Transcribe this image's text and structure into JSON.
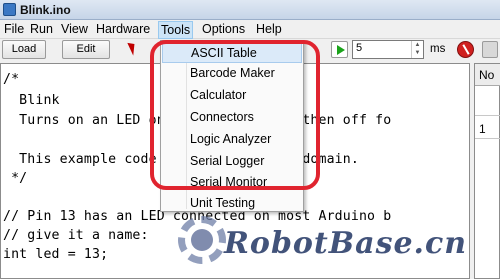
{
  "window": {
    "title": "Blink.ino",
    "icon": "arduino-app-icon"
  },
  "menubar": {
    "items": [
      "File",
      "Run",
      "View",
      "Hardware",
      "Tools",
      "Options",
      "Help"
    ],
    "active": "Tools"
  },
  "toolbar": {
    "load_label": "Load",
    "edit_label": "Edit",
    "interval_value": "5",
    "interval_unit": "ms",
    "icons": [
      "cursor-icon",
      "play-icon",
      "stop-icon"
    ]
  },
  "editor": {
    "lines": [
      "/*",
      "  Blink",
      "  Turns on an LED on for one second, then off fo",
      "",
      "  This example code is in the public domain.",
      " */",
      "",
      "// Pin 13 has an LED connected on most Arduino b",
      "// give it a name:",
      "int led = 13;"
    ]
  },
  "side_panel": {
    "header": "No",
    "value": "1"
  },
  "tools_menu": {
    "items": [
      "ASCII Table",
      "Barcode Maker",
      "Calculator",
      "Connectors",
      "Logic Analyzer",
      "Serial Logger",
      "Serial Monitor",
      "Unit Testing"
    ],
    "hovered": "ASCII Table"
  },
  "annotation": {
    "ring_color": "#e0242f"
  },
  "watermark": {
    "text": "RobotBase.cn"
  }
}
